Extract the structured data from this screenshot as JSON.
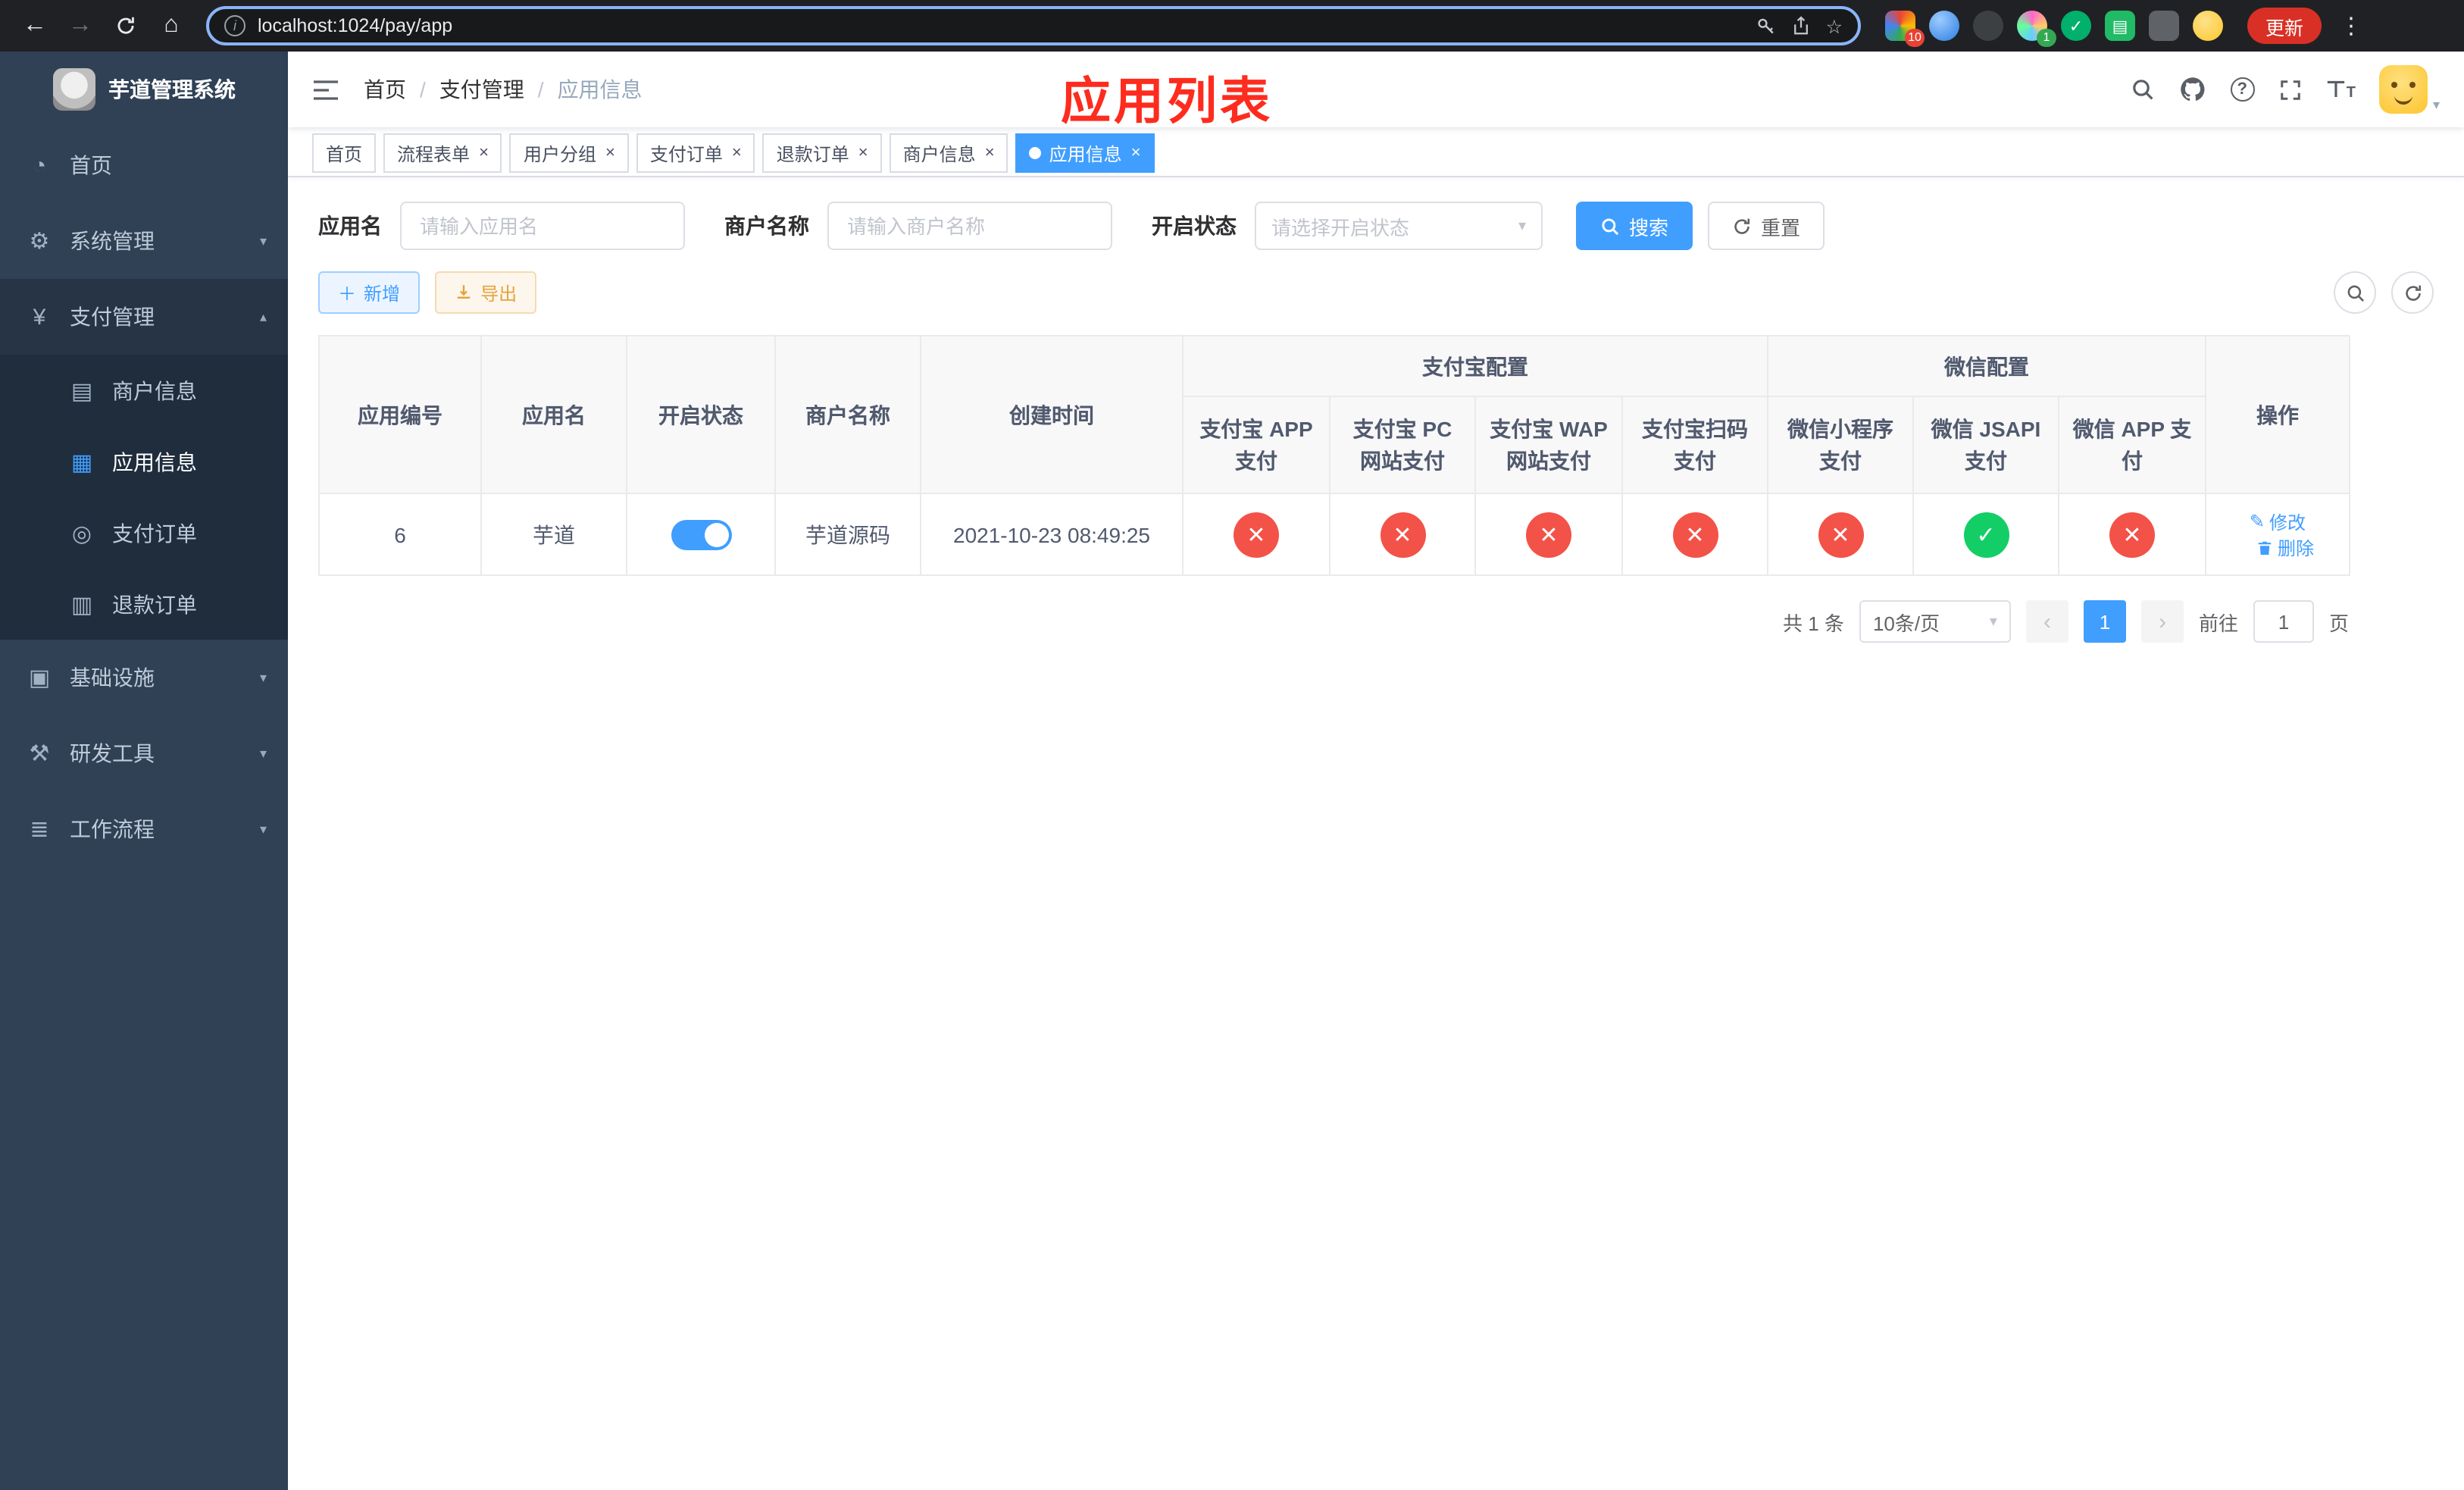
{
  "colors": {
    "primary": "#409eff",
    "success": "#13ce66",
    "danger": "#f35248",
    "sidebar_bg": "#304156",
    "annotation_red": "#fe2c1e",
    "update_red": "#d93025"
  },
  "browser": {
    "url": "localhost:1024/pay/app",
    "update_label": "更新",
    "extension_badge": "10",
    "avatar_badge": "1"
  },
  "sidebar": {
    "app_title": "芋道管理系统",
    "items": [
      {
        "label": "首页"
      },
      {
        "label": "系统管理"
      },
      {
        "label": "支付管理"
      },
      {
        "label": "商户信息"
      },
      {
        "label": "应用信息"
      },
      {
        "label": "支付订单"
      },
      {
        "label": "退款订单"
      },
      {
        "label": "基础设施"
      },
      {
        "label": "研发工具"
      },
      {
        "label": "工作流程"
      }
    ]
  },
  "header": {
    "breadcrumb": [
      "首页",
      "支付管理",
      "应用信息"
    ],
    "annotation": "应用列表"
  },
  "tabs": [
    {
      "label": "首页"
    },
    {
      "label": "流程表单"
    },
    {
      "label": "用户分组"
    },
    {
      "label": "支付订单"
    },
    {
      "label": "退款订单"
    },
    {
      "label": "商户信息"
    },
    {
      "label": "应用信息"
    }
  ],
  "filters": {
    "app_name_label": "应用名",
    "app_name_placeholder": "请输入应用名",
    "merchant_label": "商户名称",
    "merchant_placeholder": "请输入商户名称",
    "status_label": "开启状态",
    "status_placeholder": "请选择开启状态",
    "search_button": "搜索",
    "reset_button": "重置"
  },
  "toolbar": {
    "add_button": "新增",
    "export_button": "导出"
  },
  "table": {
    "main_columns": [
      "应用编号",
      "应用名",
      "开启状态",
      "商户名称",
      "创建时间"
    ],
    "groups": {
      "alipay": "支付宝配置",
      "wechat": "微信配置"
    },
    "alipay_columns": [
      "支付宝 APP 支付",
      "支付宝 PC 网站支付",
      "支付宝 WAP 网站支付",
      "支付宝扫码支付"
    ],
    "wechat_columns": [
      "微信小程序支付",
      "微信 JSAPI 支付",
      "微信 APP 支付"
    ],
    "actions_column": "操作",
    "rows": [
      {
        "id": "6",
        "name": "芋道",
        "enabled": true,
        "merchant": "芋道源码",
        "created_at": "2021-10-23 08:49:25",
        "statuses": [
          "x",
          "x",
          "x",
          "x",
          "x",
          "check",
          "x"
        ],
        "edit_label": "修改",
        "delete_label": "删除"
      }
    ]
  },
  "pagination": {
    "total_text": "共 1 条",
    "page_size": "10条/页",
    "current_page": "1",
    "goto_label": "前往",
    "goto_value": "1",
    "goto_unit": "页"
  }
}
